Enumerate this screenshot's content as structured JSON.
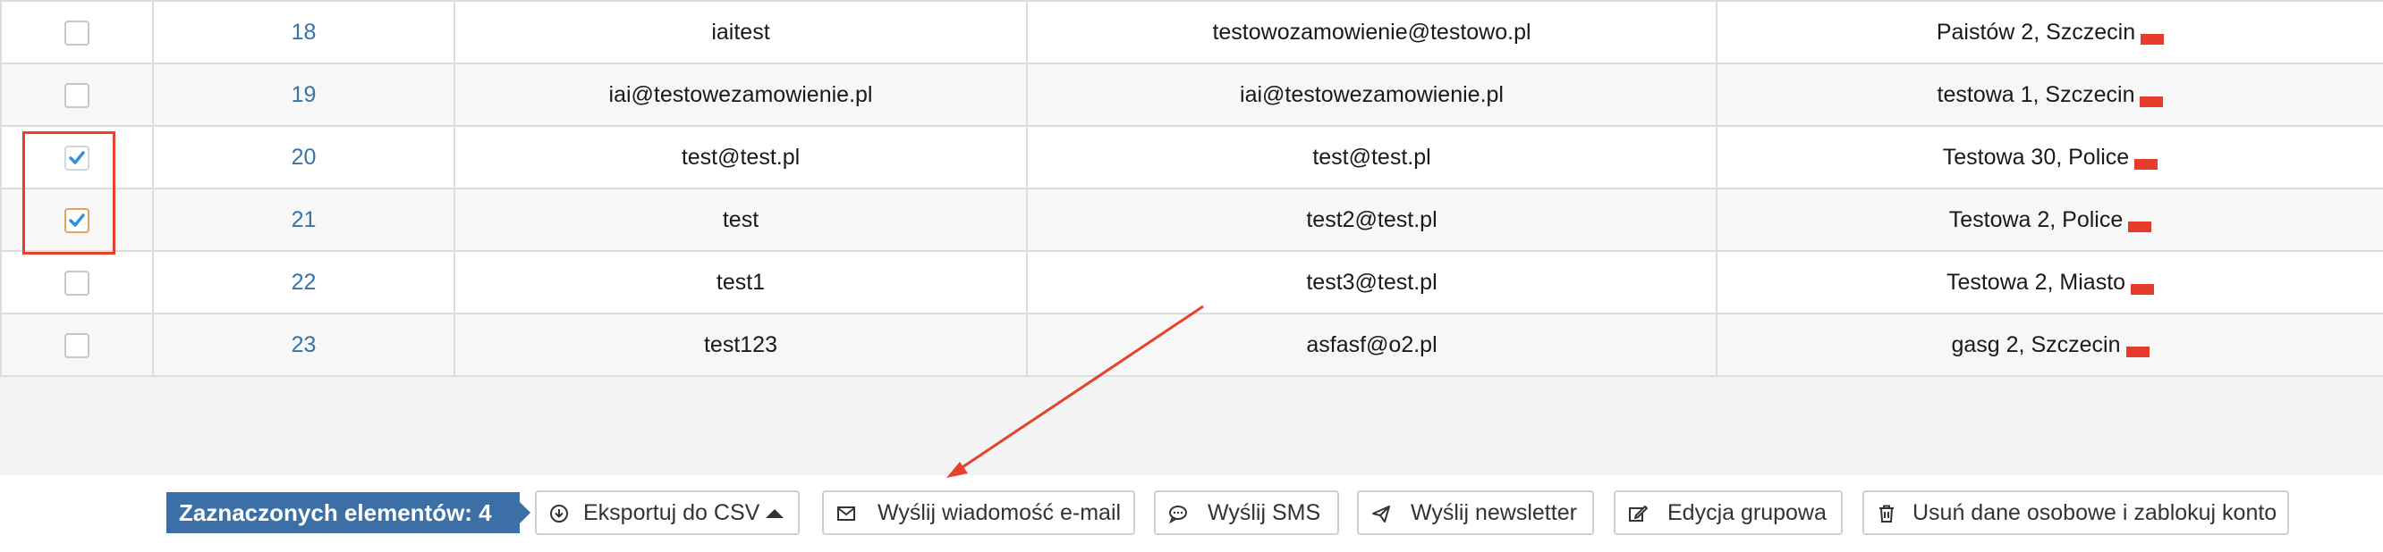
{
  "table": {
    "rows": [
      {
        "id": "18",
        "login": "iaitest",
        "email": "testowozamowienie@testowo.pl",
        "address": "Paistów 2, Szczecin",
        "checked": false
      },
      {
        "id": "19",
        "login": "iai@testowezamowienie.pl",
        "email": "iai@testowezamowienie.pl",
        "address": "testowa 1, Szczecin",
        "checked": false
      },
      {
        "id": "20",
        "login": "test@test.pl",
        "email": "test@test.pl",
        "address": "Testowa 30, Police",
        "checked": true
      },
      {
        "id": "21",
        "login": "test",
        "email": "test2@test.pl",
        "address": "Testowa 2, Police",
        "checked": true
      },
      {
        "id": "22",
        "login": "test1",
        "email": "test3@test.pl",
        "address": "Testowa 2, Miasto",
        "checked": false
      },
      {
        "id": "23",
        "login": "test123",
        "email": "asfasf@o2.pl",
        "address": "gasg 2, Szczecin",
        "checked": false
      }
    ]
  },
  "actions": {
    "selected_label": "Zaznaczonych elementów: 4",
    "export_csv": "Eksportuj do CSV",
    "send_email": "Wyślij wiadomość e-mail",
    "send_sms": "Wyślij SMS",
    "send_newsletter": "Wyślij newsletter",
    "group_edit": "Edycja grupowa",
    "delete_data": "Usuń dane osobowe i zablokuj konto"
  },
  "colors": {
    "accent": "#3d6fa7",
    "link": "#3573a8",
    "annotation": "#e5412c",
    "flag": "#e53c2e"
  },
  "icons": {
    "export": "download-circle-icon",
    "email": "envelope-icon",
    "sms": "speech-bubble-icon",
    "newsletter": "paper-plane-icon",
    "group_edit": "edit-icon",
    "delete": "trash-icon"
  }
}
